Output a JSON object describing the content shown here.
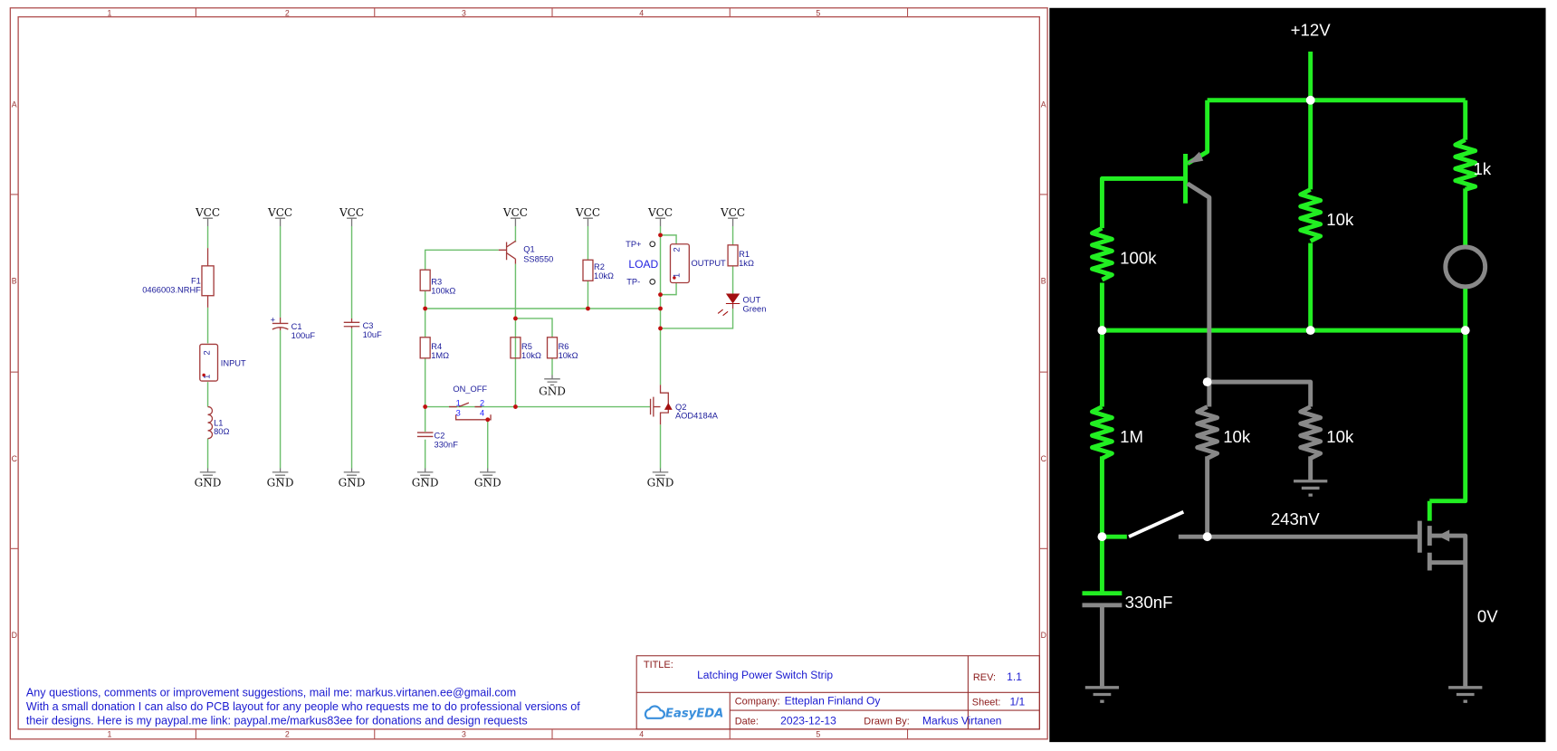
{
  "frame": {
    "columns": [
      "1",
      "2",
      "3",
      "4",
      "5"
    ],
    "rows": [
      "A",
      "B",
      "C",
      "D"
    ]
  },
  "schematic": {
    "power_label": "VCC",
    "ground_label": "GND",
    "F1": {
      "ref": "F1",
      "value": "0466003.NRHF"
    },
    "input": {
      "name": "INPUT",
      "pin1": "1",
      "pin2": "2"
    },
    "L1": {
      "ref": "L1",
      "value": "80Ω"
    },
    "C1": {
      "ref": "C1",
      "value": "100uF",
      "polarity": "+"
    },
    "C3": {
      "ref": "C3",
      "value": "10uF"
    },
    "R3": {
      "ref": "R3",
      "value": "100kΩ"
    },
    "R4": {
      "ref": "R4",
      "value": "1MΩ"
    },
    "C2": {
      "ref": "C2",
      "value": "330nF"
    },
    "switch": {
      "name": "ON_OFF",
      "pins": [
        "1",
        "2",
        "3",
        "4"
      ]
    },
    "Q1": {
      "ref": "Q1",
      "value": "SS8550"
    },
    "R5": {
      "ref": "R5",
      "value": "10kΩ"
    },
    "R6": {
      "ref": "R6",
      "value": "10kΩ"
    },
    "R2": {
      "ref": "R2",
      "value": "10kΩ"
    },
    "output": {
      "name": "OUTPUT",
      "pin1": "1",
      "pin2": "2",
      "tp_plus": "TP+",
      "tp_minus": "TP-",
      "load": "LOAD"
    },
    "R1": {
      "ref": "R1",
      "value": "1kΩ"
    },
    "LED": {
      "ref": "OUT",
      "value": "Green"
    },
    "Q2": {
      "ref": "Q2",
      "value": "AOD4184A"
    }
  },
  "notes": [
    "Any questions, comments or improvement suggestions, mail me: markus.virtanen.ee@gmail.com",
    "With a small donation I can also do PCB layout for any people who requests me to do professional versions of",
    "their designs. Here is my paypal.me link: paypal.me/markus83ee for donations and design requests"
  ],
  "title_block": {
    "title_label": "TITLE:",
    "title": "Latching Power Switch Strip",
    "rev_label": "REV:",
    "rev": "1.1",
    "company_label": "Company:",
    "company": "Etteplan Finland Oy",
    "sheet_label": "Sheet:",
    "sheet": "1/1",
    "date_label": "Date:",
    "date": "2023-12-13",
    "drawn_by_label": "Drawn By:",
    "drawn_by": "Markus Virtanen",
    "logo": "EasyEDA"
  },
  "simulation": {
    "supply": "+12V",
    "r_base": "100k",
    "r_mid": "10k",
    "r_led": "1k",
    "r_bias": "1M",
    "r_collector": "10k",
    "r_pulldown": "10k",
    "gate_voltage": "243nV",
    "capacitor": "330nF",
    "drain_voltage": "0V",
    "colors": {
      "background": "#000000",
      "active_wire": "#22ee22",
      "inactive_wire": "#888888",
      "switch": "#ffffff"
    }
  }
}
